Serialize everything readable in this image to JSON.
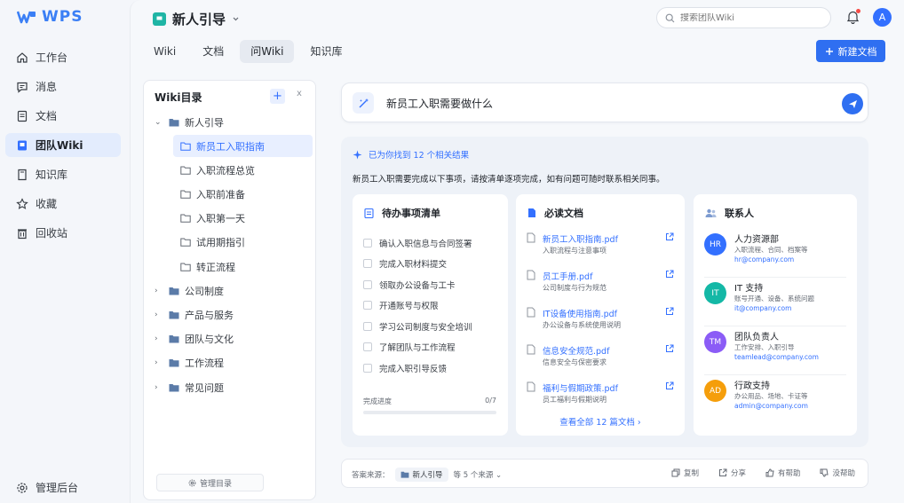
{
  "app": {
    "logo_text": "WPS",
    "brand_color": "#3b7ff5"
  },
  "nav": {
    "items": [
      {
        "label": "工作台",
        "icon": "home-icon"
      },
      {
        "label": "消息",
        "icon": "message-icon"
      },
      {
        "label": "文档",
        "icon": "document-icon"
      },
      {
        "label": "团队Wiki",
        "icon": "wiki-icon"
      },
      {
        "label": "知识库",
        "icon": "knowledge-icon"
      },
      {
        "label": "收藏",
        "icon": "star-icon"
      },
      {
        "label": "回收站",
        "icon": "trash-icon"
      }
    ],
    "admin_label": "管理后台"
  },
  "header": {
    "space_title": "新人引导",
    "search_placeholder": "搜索团队Wiki",
    "avatar_letter": "A"
  },
  "tabs": [
    "Wiki",
    "文档",
    "问Wiki",
    "知识库"
  ],
  "new_doc_label": "新建文档",
  "tree": {
    "title": "Wiki目录",
    "add_symbol": "+",
    "collapse_symbol": "x",
    "root": "新人引导",
    "children": [
      "新员工入职指南",
      "入职流程总览",
      "入职前准备",
      "入职第一天",
      "试用期指引",
      "转正流程"
    ],
    "folders": [
      "公司制度",
      "产品与服务",
      "团队与文化",
      "工作流程",
      "常见问题"
    ],
    "manage_label": "管理目录"
  },
  "query": {
    "text": "新员工入职需要做什么"
  },
  "result": {
    "found_text": "已为你找到 12 个相关结果",
    "summary": "新员工入职需要完成以下事项，请按清单逐项完成，如有问题可随时联系相关同事。",
    "todo": {
      "title": "待办事项清单",
      "items": [
        "确认入职信息与合同签署",
        "完成入职材料提交",
        "领取办公设备与工卡",
        "开通账号与权限",
        "学习公司制度与安全培训",
        "了解团队与工作流程",
        "完成入职引导反馈"
      ],
      "progress_label": "完成进度",
      "progress_value": "0/7",
      "progress_fraction": 0
    },
    "docs": {
      "title": "必读文档",
      "items": [
        {
          "name": "新员工入职指南.pdf",
          "desc": "入职流程与注意事项"
        },
        {
          "name": "员工手册.pdf",
          "desc": "公司制度与行为规范"
        },
        {
          "name": "IT设备使用指南.pdf",
          "desc": "办公设备与系统使用说明"
        },
        {
          "name": "信息安全规范.pdf",
          "desc": "信息安全与保密要求"
        },
        {
          "name": "福利与假期政策.pdf",
          "desc": "员工福利与假期说明"
        }
      ],
      "view_all": "查看全部 12 篇文档"
    },
    "contacts": {
      "title": "联系人",
      "items": [
        {
          "initials": "HR",
          "name": "人力资源部",
          "desc": "入职流程、合同、档案等",
          "email": "hr@company.com",
          "color": "#3370ff"
        },
        {
          "initials": "IT",
          "name": "IT 支持",
          "desc": "账号开通、设备、系统问题",
          "email": "it@company.com",
          "color": "#14b8a6"
        },
        {
          "initials": "TM",
          "name": "团队负责人",
          "desc": "工作安排、入职引导",
          "email": "teamlead@company.com",
          "color": "#8b5cf6"
        },
        {
          "initials": "AD",
          "name": "行政支持",
          "desc": "办公用品、场地、卡证等",
          "email": "admin@company.com",
          "color": "#f59e0b"
        }
      ]
    }
  },
  "footer": {
    "source_label": "答案来源：",
    "source_chip": "新人引导",
    "more_sources": "等 5 个来源",
    "actions": [
      "复制",
      "分享",
      "有帮助",
      "没帮助"
    ]
  }
}
